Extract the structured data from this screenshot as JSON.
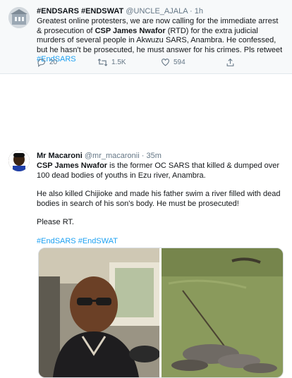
{
  "tweet1": {
    "display_name": "#ENDSARS #ENDSWAT",
    "handle": "@UNCLE_AJALA",
    "separator": "·",
    "time": "1h",
    "text_before": "Greatest online protesters, we are now calling for the immediate arrest & prosecution of ",
    "text_bold": "CSP James Nwafor",
    "text_after": " (RTD) for the extra judicial murders of several people in Akwuzu SARS, Anambra. He confessed, but he hasn't be prosecuted, he must answer for his crimes. Pls retweet ",
    "hashtag": "#EndSARS",
    "replies": "20",
    "retweets": "1.5K",
    "likes": "594",
    "icons": [
      "reply-icon",
      "retweet-icon",
      "like-icon",
      "share-icon"
    ]
  },
  "tweet2": {
    "display_name": "Mr Macaroni",
    "handle": "@mr_macaronii",
    "separator": "·",
    "time": "35m",
    "p1_bold": "CSP James Nwafor",
    "p1_rest": " is the former OC SARS that killed & dumped over 100 dead bodies of youths in Ezu river, Anambra.",
    "p2": "He also killed Chijioke and made his father swim a river filled with dead bodies in search of his son's body. He must be prosecuted!",
    "p3": "Please RT.",
    "hashtags": "#EndSARS #EndSWAT"
  },
  "colors": {
    "link": "#1da1f2",
    "muted": "#657786",
    "text": "#14171a"
  }
}
